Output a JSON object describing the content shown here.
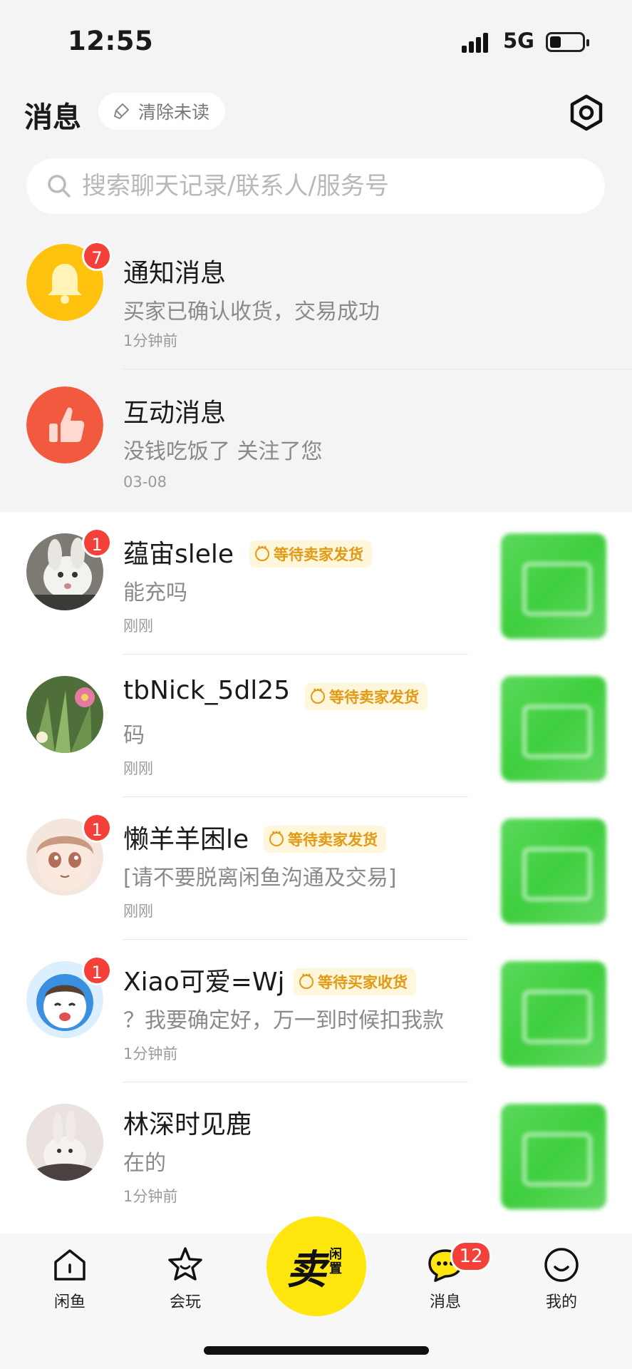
{
  "status_bar": {
    "time": "12:55",
    "network": "5G"
  },
  "header": {
    "title": "消息",
    "clear_unread": "清除未读"
  },
  "search": {
    "placeholder": "搜索聊天记录/联系人/服务号"
  },
  "system_rows": [
    {
      "title": "通知消息",
      "preview": "买家已确认收货，交易成功",
      "time": "1分钟前",
      "badge": "7",
      "icon": "bell-icon",
      "color": "#ffc20e"
    },
    {
      "title": "互动消息",
      "preview": "没钱吃饭了 关注了您",
      "time": "03-08",
      "icon": "thumbs-up-icon",
      "color": "#f25a3f"
    }
  ],
  "chats": [
    {
      "name": "蕴宙slele",
      "tag": "等待卖家发货",
      "preview": "能充吗",
      "time": "刚刚",
      "badge": "1"
    },
    {
      "name": "tbNick_5dl25",
      "tag": "等待卖家发货",
      "preview": "码",
      "time": "刚刚",
      "badge": ""
    },
    {
      "name": "懒羊羊困le",
      "tag": "等待卖家发货",
      "preview": "[请不要脱离闲鱼沟通及交易]",
      "time": "刚刚",
      "badge": "1"
    },
    {
      "name": "Xiao可爱=Wj",
      "tag": "等待买家收货",
      "preview": "？我要确定好，万一到时候扣我款",
      "time": "1分钟前",
      "badge": "1"
    },
    {
      "name": "林深时见鹿",
      "tag": "",
      "preview": "在的",
      "time": "1分钟前",
      "badge": ""
    }
  ],
  "nav": {
    "home": "闲鱼",
    "play": "会玩",
    "sell_main": "卖",
    "sell_sub": "闲置",
    "messages": "消息",
    "messages_badge": "12",
    "mine": "我的"
  }
}
